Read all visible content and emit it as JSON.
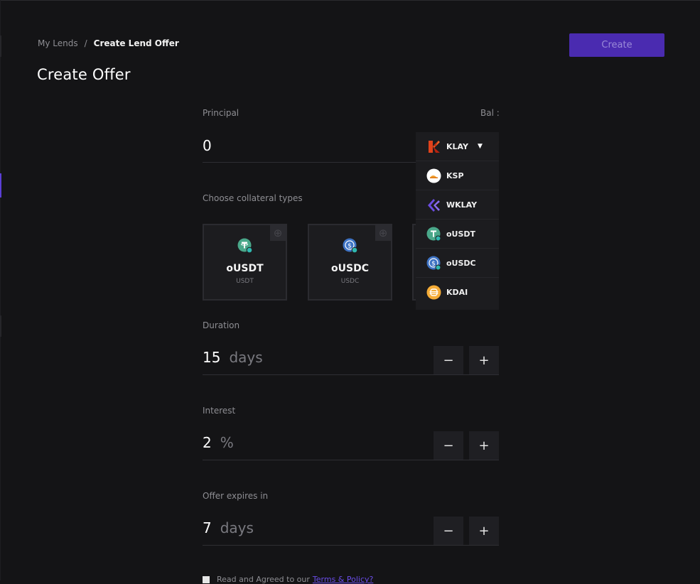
{
  "breadcrumb": {
    "parent": "My Lends",
    "separator": "/",
    "current": "Create Lend Offer"
  },
  "page_title": "Create Offer",
  "create_button": "Create",
  "principal": {
    "label": "Principal",
    "balance_label": "Bal :",
    "value": "0",
    "selected_token": "KLAY"
  },
  "collateral": {
    "label": "Choose collateral types",
    "cards": [
      {
        "name": "oUSDT",
        "sub": "USDT",
        "icon": "ousdt-icon"
      },
      {
        "name": "oUSDC",
        "sub": "USDC",
        "icon": "ousdc-icon"
      }
    ]
  },
  "duration": {
    "label": "Duration",
    "value": "15",
    "unit": "days"
  },
  "interest": {
    "label": "Interest",
    "value": "2",
    "unit": "%"
  },
  "expires": {
    "label": "Offer expires in",
    "value": "7",
    "unit": "days"
  },
  "stepper": {
    "minus": "−",
    "plus": "+"
  },
  "token_dropdown": [
    {
      "symbol": "KLAY",
      "icon": "klay-icon"
    },
    {
      "symbol": "KSP",
      "icon": "ksp-icon"
    },
    {
      "symbol": "WKLAY",
      "icon": "wklay-icon"
    },
    {
      "symbol": "oUSDT",
      "icon": "ousdt-icon"
    },
    {
      "symbol": "oUSDC",
      "icon": "ousdc-icon"
    },
    {
      "symbol": "KDAI",
      "icon": "kdai-icon"
    }
  ],
  "terms": {
    "text": "Read and Agreed to our",
    "link": "Terms & Policy?"
  },
  "colors": {
    "accent": "#4a2bb0",
    "background": "#141416",
    "panel": "#1c1c1f"
  }
}
